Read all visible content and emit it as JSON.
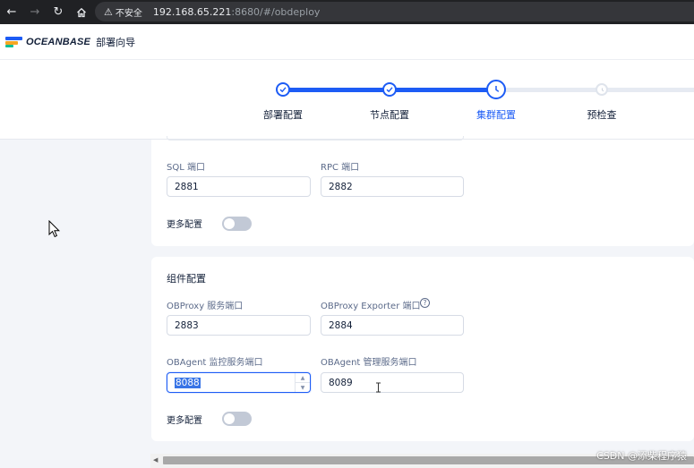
{
  "browser": {
    "security_label": "不安全",
    "url_host": "192.168.65.221",
    "url_rest": ":8680/#/obdeploy"
  },
  "header": {
    "logo_text": "OCEANBASE",
    "app_name": "部署向导"
  },
  "steps": [
    {
      "label": "部署配置",
      "state": "done"
    },
    {
      "label": "节点配置",
      "state": "done"
    },
    {
      "label": "集群配置",
      "state": "active"
    },
    {
      "label": "预检查",
      "state": "pending"
    }
  ],
  "cluster_section": {
    "sql_port_label": "SQL 端口",
    "sql_port_value": "2881",
    "rpc_port_label": "RPC 端口",
    "rpc_port_value": "2882",
    "more_config_label": "更多配置"
  },
  "component_section": {
    "title": "组件配置",
    "obproxy_port_label": "OBProxy 服务端口",
    "obproxy_port_value": "2883",
    "obproxy_exporter_label": "OBProxy Exporter 端口",
    "obproxy_exporter_value": "2884",
    "obagent_monitor_label": "OBAgent 监控服务端口",
    "obagent_monitor_value": "8088",
    "obagent_manage_label": "OBAgent 管理服务端口",
    "obagent_manage_value": "8089",
    "more_config_label": "更多配置"
  },
  "watermark": "CSDN @添柴程序猿",
  "colors": {
    "primary": "#1d5cf5",
    "track_pending": "#e6eaf2",
    "page_bg": "#f3f5f9"
  }
}
